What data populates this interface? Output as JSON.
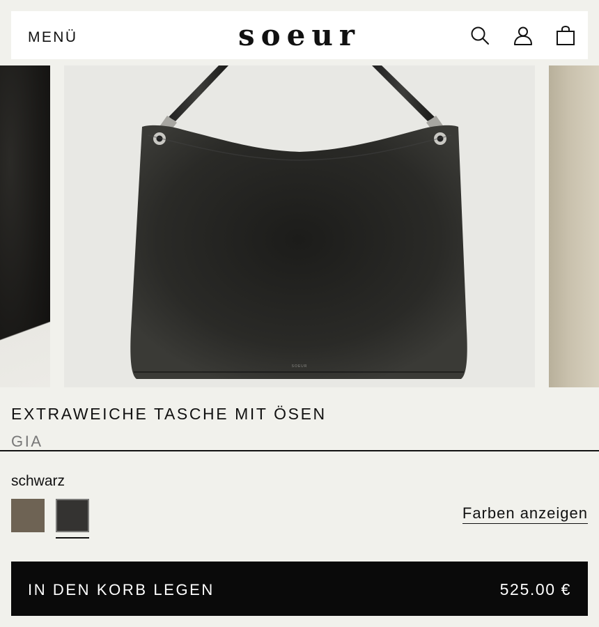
{
  "header": {
    "menu_label": "MENÜ",
    "logo_text": "soeur",
    "icons": [
      "search-icon",
      "account-icon",
      "shopping-bag-icon"
    ]
  },
  "gallery": {
    "bag_stamp": "SOEUR"
  },
  "product": {
    "title": "EXTRAWEICHE TASCHE MIT ÖSEN",
    "name": "GIA",
    "selected_color": "schwarz",
    "swatches": [
      {
        "color": "#6e6354",
        "selected": false
      },
      {
        "color": "#343331",
        "selected": true
      }
    ],
    "show_colors_label": "Farben anzeigen"
  },
  "cart": {
    "button_label": "IN DEN KORB LEGEN",
    "price": "525.00 €"
  }
}
